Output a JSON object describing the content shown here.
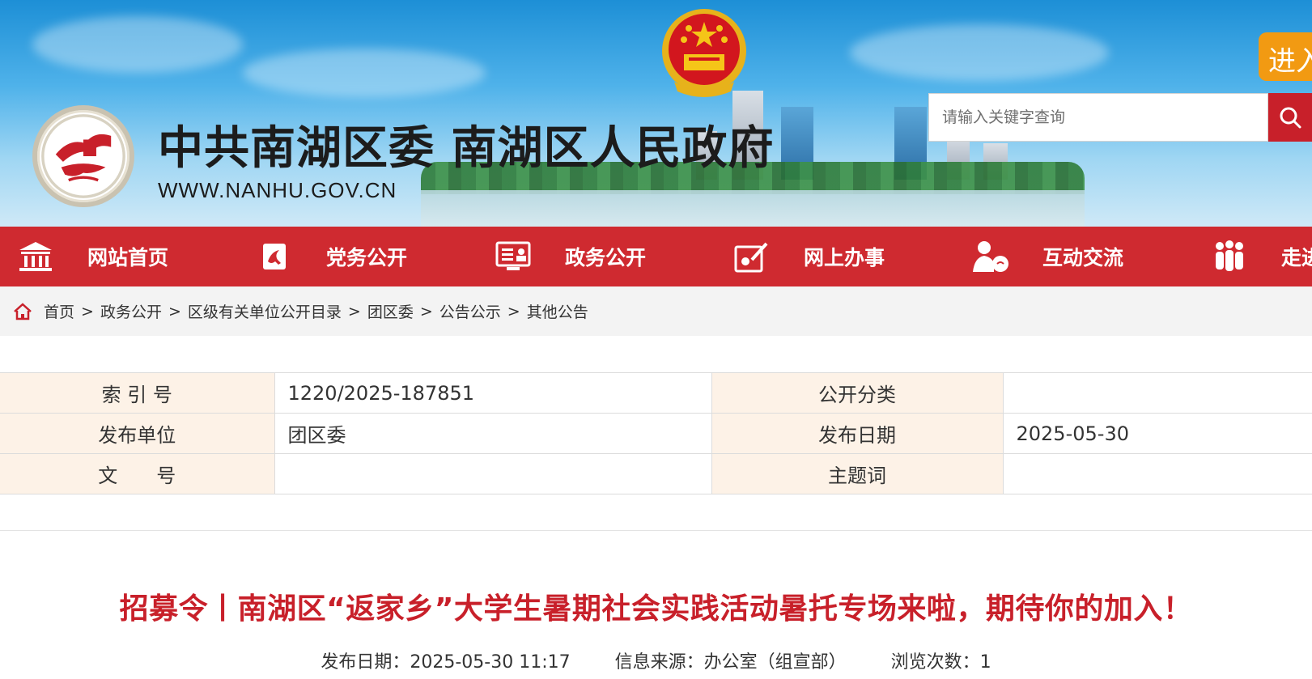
{
  "header": {
    "site_title": "中共南湖区委 南湖区人民政府",
    "site_url": "WWW.NANHU.GOV.CN",
    "search_placeholder": "请输入关键字查询",
    "enter_label": "进入",
    "colors": {
      "brand_red": "#cf2a30",
      "accent_orange": "#f29a12"
    },
    "icons": {
      "search": "search-icon",
      "emblem": "national-emblem-icon",
      "logo": "nanhu-logo"
    }
  },
  "nav": {
    "items": [
      {
        "label": "网站首页",
        "icon": "temple-icon"
      },
      {
        "label": "党务公开",
        "icon": "party-flag-icon"
      },
      {
        "label": "政务公开",
        "icon": "document-board-icon"
      },
      {
        "label": "网上办事",
        "icon": "service-pen-icon"
      },
      {
        "label": "互动交流",
        "icon": "chat-user-icon"
      },
      {
        "label": "走进",
        "icon": "people-group-icon"
      }
    ]
  },
  "breadcrumb": {
    "items": [
      "首页",
      "政务公开",
      "区级有关单位公开目录",
      "团区委",
      "公告公示",
      "其他公告"
    ],
    "separator": ">"
  },
  "info": {
    "index_label": "索 引 号",
    "index_value": "1220/2025-187851",
    "category_label": "公开分类",
    "category_value": "",
    "publisher_label": "发布单位",
    "publisher_value": "团区委",
    "date_label": "发布日期",
    "date_value": "2025-05-30",
    "docno_label": "文　　号",
    "docno_value": "",
    "subject_label": "主题词",
    "subject_value": ""
  },
  "article": {
    "title": "招募令丨南湖区“返家乡”大学生暑期社会实践活动暑托专场来啦，期待你的加入！",
    "publish": "发布日期：2025-05-30 11:17",
    "source": "信息来源：办公室（组宣部）",
    "views": "浏览次数：1"
  }
}
